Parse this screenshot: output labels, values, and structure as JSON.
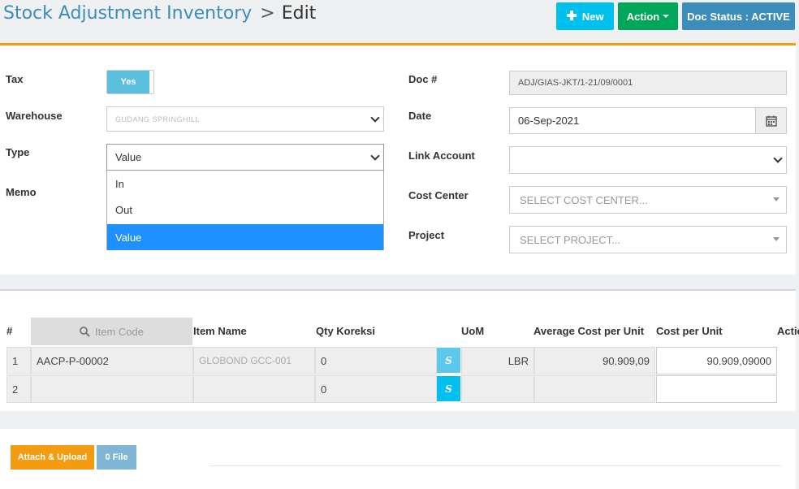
{
  "header": {
    "breadcrumb_parent": "Stock Adjustment Inventory",
    "breadcrumb_sep": ">",
    "breadcrumb_current": "Edit",
    "new_label": "New",
    "action_label": "Action",
    "status_label": "Doc Status : ACTIVE"
  },
  "form": {
    "tax_label": "Tax",
    "tax_value": "Yes",
    "warehouse_label": "Warehouse",
    "warehouse_value": "GUDANG SPRINGHILL",
    "type_label": "Type",
    "type_value": "Value",
    "type_options": [
      "In",
      "Out",
      "Value"
    ],
    "memo_label": "Memo",
    "doc_label": "Doc #",
    "doc_value": "ADJ/GIAS-JKT/1-21/09/0001",
    "date_label": "Date",
    "date_value": "06-Sep-2021",
    "link_account_label": "Link Account",
    "link_account_value": "",
    "cost_center_label": "Cost Center",
    "cost_center_placeholder": "SELECT COST CENTER...",
    "project_label": "Project",
    "project_placeholder": "SELECT PROJECT..."
  },
  "table": {
    "headers": {
      "num": "#",
      "item_code": "Item Code",
      "item_name": "Item Name",
      "qty": "Qty Koreksi",
      "uom": "UoM",
      "avg_cost": "Average Cost per Unit",
      "cost": "Cost per Unit",
      "action": "Actio"
    },
    "rows": [
      {
        "num": "1",
        "item_code": "AACP-P-00002",
        "item_name": "GLOBOND GCC-001",
        "qty": "0",
        "s": "S",
        "uom": "LBR",
        "avg_cost": "90.909,09",
        "cost": "90.909,09000"
      },
      {
        "num": "2",
        "item_code": "",
        "item_name": "",
        "qty": "0",
        "s": "S",
        "uom": "",
        "avg_cost": "",
        "cost": ""
      }
    ]
  },
  "attach": {
    "upload_label": "Attach & Upload",
    "file_count_label": "0 File"
  }
}
